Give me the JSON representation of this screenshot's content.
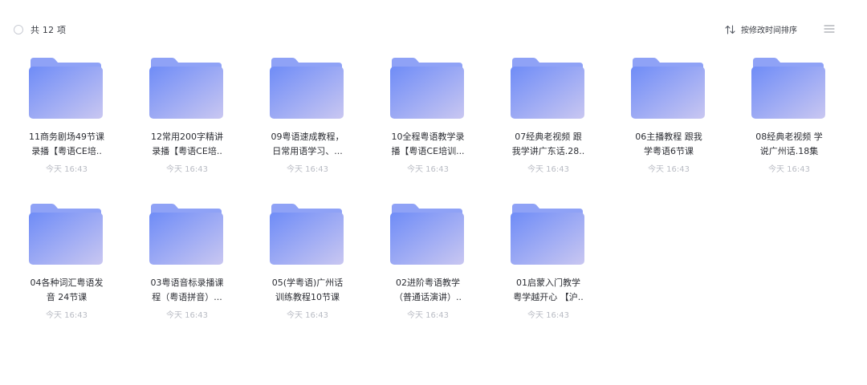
{
  "header": {
    "count_label": "共 12 项",
    "sort_label": "按修改时间排序",
    "sort_icon": "sort-arrows-icon",
    "view_icon": "list-view-icon"
  },
  "colors": {
    "folder_top": "#8fa2f6",
    "folder_front_start": "#6f8cf7",
    "folder_front_end": "#c9c7f1"
  },
  "folders": [
    {
      "name": "11商务剧场49节课\n录播【粤语CE培..",
      "time": "今天 16:43"
    },
    {
      "name": "12常用200字精讲\n录播【粤语CE培..",
      "time": "今天 16:43"
    },
    {
      "name": "09粤语速成教程，\n日常用语学习、...",
      "time": "今天 16:43"
    },
    {
      "name": "10全程粤语教学录\n播【粤语CE培训...",
      "time": "今天 16:43"
    },
    {
      "name": "07经典老视频 跟\n我学讲广东话.28..",
      "time": "今天 16:43"
    },
    {
      "name": "06主播教程 跟我\n学粤语6节课",
      "time": "今天 16:43"
    },
    {
      "name": "08经典老视频 学\n说广州话.18集",
      "time": "今天 16:43"
    },
    {
      "name": "04各种词汇粤语发\n音 24节课",
      "time": "今天 16:43"
    },
    {
      "name": "03粤语音标录播课\n程（粤语拼音）...",
      "time": "今天 16:43"
    },
    {
      "name": "05(学粤语)广州话\n训练教程10节课",
      "time": "今天 16:43"
    },
    {
      "name": "02进阶粤语教学\n（普通话演讲）..",
      "time": "今天 16:43"
    },
    {
      "name": "01启蒙入门教学\n粤学越开心 【沪..",
      "time": "今天 16:43"
    }
  ]
}
